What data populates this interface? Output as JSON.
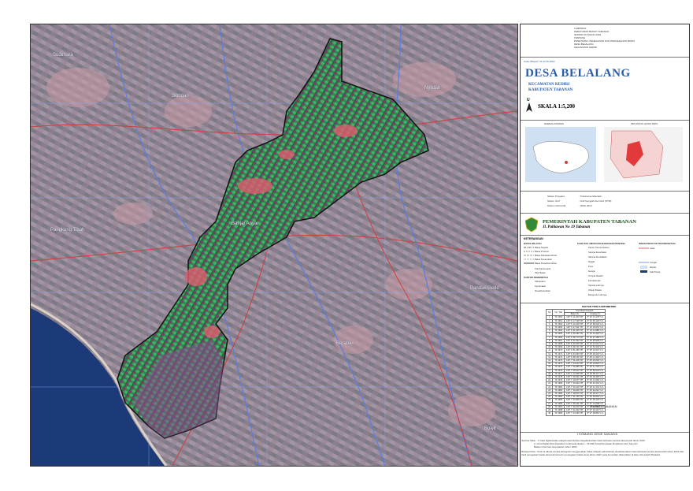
{
  "header": {
    "lines": [
      "LAMPIRAN",
      "PERATURAN BUPATI TABANAN",
      "NOMOR 20 TAHUN 2023",
      "TENTANG",
      "PENETAPAN, PENEGASAN DAN PENGESAHAN BATAS",
      "DESA BELALANG",
      "KECAMATAN KEDIRI"
    ]
  },
  "title": {
    "kode": "Kode Wilayah: 51.02.06.2003",
    "name": "DESA BELALANG",
    "kecamatan": "KECAMATAN KEDIRI",
    "kabupaten": "KABUPATEN TABANAN",
    "north": "U",
    "scale": "SKALA 1:5,200"
  },
  "inset": {
    "left_title": "DAERAH DIAWAS",
    "right_title": "PETUNJUK LETAK PETA"
  },
  "projection": [
    {
      "label": "Sistem Proyeksi",
      "value": "Transverse Mercator"
    },
    {
      "label": "Sistem Grid",
      "value": "Grid Geografi dan Grid (UTM)"
    },
    {
      "label": "Datum Horizontal",
      "value": "SRGI 2013"
    }
  ],
  "agency": {
    "name": "PEMERINTAH KABUPATEN TABANAN",
    "address": "Jl. Pahlawan No 19 Tabanan"
  },
  "legend": {
    "title": "KETERANGAN",
    "col1_title": "BATAS WILAYAH",
    "col1": [
      "Batas Negara",
      "Batas Provinsi",
      "Batas Kabupaten/Kota",
      "Batas Kecamatan",
      "Batas Desa/Kelurahan"
    ],
    "col2_title": "FASILITAS UMUM DAN BANGUNAN PENTING",
    "col2": [
      "Kantor Pemerintahan",
      "Sarana Kesehatan",
      "Sarana Pendidikan",
      "Masjid",
      "Pura",
      "Gereja",
      "Tempat Ibadah",
      "Pemakaman",
      "Sarana Lainnya",
      "Objek Wisata",
      "Bangunan Lainnya"
    ],
    "col3_title": "INFRASTRUKTUR TRANSPORTASI",
    "col3": [
      "Jalan",
      "Sungai",
      "Danau",
      "Kali Pantai"
    ],
    "col4_title": "KANTOR PEMERINTAH",
    "col4": [
      "Kabupaten",
      "Kecamatan",
      "Desa/Kelurahan",
      "Titik Kartometrik",
      "Pilar Batas"
    ]
  },
  "coord_table": {
    "title": "DAFTAR TITIK KARTOMETRIK",
    "group": "Koordinat Geografi",
    "headers": [
      "No",
      "No. Titik",
      "Bujur (X)",
      "Lintang (Y)"
    ],
    "rows": [
      [
        "1",
        "TK 1960",
        "115° 6' 11.823\" BT",
        "8° 33' 43.478\" LS"
      ],
      [
        "2",
        "TK 1961",
        "115° 6' 17.190\" BT",
        "8° 33' 50.120\" LS"
      ],
      [
        "3",
        "TK 1962",
        "115° 6' 22.045\" BT",
        "8° 33' 58.002\" LS"
      ],
      [
        "4",
        "TK 1963",
        "115° 6' 27.611\" BT",
        "8° 34' 04.651\" LS"
      ],
      [
        "5",
        "TK 1964",
        "115° 6' 31.906\" BT",
        "8° 34' 11.885\" LS"
      ],
      [
        "6",
        "TK 1965",
        "115° 6' 35.282\" BT",
        "8° 34' 19.332\" LS"
      ],
      [
        "7",
        "TK 1966",
        "115° 6' 38.774\" BT",
        "8° 34' 27.180\" LS"
      ],
      [
        "8",
        "TK 1967",
        "115° 6' 41.502\" BT",
        "8° 34' 35.906\" LS"
      ],
      [
        "9",
        "TK 1968",
        "115° 6' 45.006\" BT",
        "8° 34' 44.014\" LS"
      ],
      [
        "10",
        "TK 1969",
        "115° 6' 48.721\" BT",
        "8° 34' 52.340\" LS"
      ],
      [
        "11",
        "TK 1970",
        "115° 6' 51.066\" BT",
        "8° 35' 01.527\" LS"
      ],
      [
        "12",
        "TK 1971",
        "115° 6' 54.930\" BT",
        "8° 35' 09.415\" LS"
      ],
      [
        "13",
        "TK 1972",
        "115° 6' 58.152\" BT",
        "8° 35' 17.260\" LS"
      ],
      [
        "14",
        "TK 1973",
        "115° 7' 01.445\" BT",
        "8° 35' 25.093\" LS"
      ],
      [
        "15",
        "TK 1974",
        "115° 7' 04.012\" BT",
        "8° 35' 33.822\" LS"
      ],
      [
        "16",
        "TK 1975",
        "115° 7' 06.880\" BT",
        "8° 35' 41.765\" LS"
      ],
      [
        "17",
        "TK 1976",
        "115° 7' 09.512\" BT",
        "8° 35' 50.034\" LS"
      ],
      [
        "18",
        "TK 1977",
        "115° 7' 12.648\" BT",
        "8° 35' 58.117\" LS"
      ],
      [
        "19",
        "TK 1978",
        "115° 7' 15.301\" BT",
        "8° 36' 06.482\" LS"
      ],
      [
        "20",
        "TK 1979",
        "115° 7' 18.077\" BT",
        "8° 36' 14.990\" LS"
      ],
      [
        "21",
        "TK 1980",
        "115° 7' 20.934\" BT",
        "8° 36' 23.151\" LS"
      ],
      [
        "22",
        "TK 1981",
        "115° 7' 23.410\" BT",
        "8° 36' 31.716\" LS"
      ],
      [
        "23",
        "TK 1982",
        "115° 7' 26.006\" BT",
        "8° 36' 40.012\" LS"
      ],
      [
        "24",
        "TK 1983",
        "115° 7' 28.875\" BT",
        "8° 36' 48.377\" LS"
      ],
      [
        "25",
        "TK 1984",
        "115° 7' 31.150\" BT",
        "8° 36' 56.802\" LS"
      ],
      [
        "26",
        "TK 1985",
        "115° 7' 33.905\" BT",
        "8° 37' 05.140\" LS"
      ],
      [
        "27",
        "TK 1986",
        "115° 7' 36.441\" BT",
        "8° 37' 13.608\" LS"
      ],
      [
        "28",
        "TK 1987",
        "115° 7' 39.015\" BT",
        "8° 37' 21.906\" LS"
      ],
      [
        "29",
        "TK 1988",
        "115° 7' 41.602\" BT",
        "8° 37' 30.447\" LS"
      ],
      [
        "30",
        "TK 1989",
        "115° 7' 44.183\" BT",
        "8° 37' 38.881\" LS"
      ]
    ]
  },
  "signature": {
    "role": "BUPATI TABANAN",
    "name": "I KOMANG GEDE SANJAYA"
  },
  "sources": {
    "sumber_label": "Sumber Data :",
    "sumber": [
      "1. Data digital batas wilayah administrasi desa/kelurahan hasil delineasi secara kartometrik tahun 2016",
      "2. Citra Digital Peta Rupabumi Indonesia skala 1 : 25.000 Pusat Pemetaan Rupabumi dan Toponim",
      "   Badan Informasi Geospasial, tahun 2000"
    ],
    "riwayat_label": "Riwayat Peta :",
    "riwayat": "Peta ini dibuat secara kartografi menggunakan batas wilayah administrasi desa/kelurahan hasil delineasi secara kartometrik tahun 2016 dan hasil penegasan batas desa bersama tim penegasan batas desa tahun 2022 yang kemudian ditampilkan di atas citra satelit Pleiades"
  },
  "map": {
    "places": [
      "Sudimara",
      "Bongan",
      "Nyitdah",
      "Pangkung Tibah",
      "Banjar Anyar",
      "Pandak Gede",
      "Beraban",
      "Buwit"
    ],
    "colors": {
      "boundary": "#111111",
      "road": "#d43c3c",
      "river": "#5a7fe0",
      "grid": "#8aa8ff",
      "sea": "#1d3a78",
      "village": "#2a9a55"
    }
  }
}
